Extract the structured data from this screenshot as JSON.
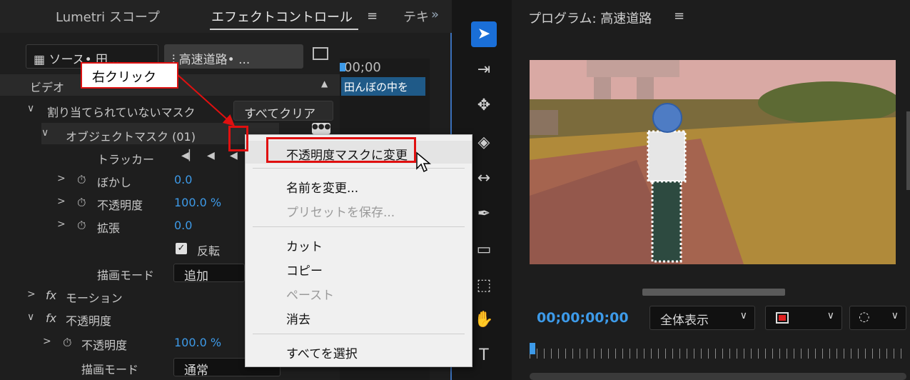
{
  "effect_panel": {
    "tabs": [
      "Lumetri スコープ",
      "エフェクトコントロール",
      "テキ"
    ],
    "tab_menu_icon": "hamburger-icon",
    "expand_icon": "double-chevron-right-icon",
    "source_button": "ソース• 田...",
    "sequence_button": "高速道路• ...",
    "timecode": "00;00",
    "clip_label": "田んぼの中を",
    "section_video": "ビデオ",
    "unassigned_masks": "割り当てられていないマスク",
    "clear_all_button": "すべてクリア",
    "object_mask": "オブジェクトマスク (01)",
    "tracker_label": "トラッカー",
    "blur_label": "ぼかし",
    "blur_value": "0.0",
    "opacity_label": "不透明度",
    "opacity_value": "100.0 %",
    "expand_label": "拡張",
    "expand_value": "0.0",
    "invert_label": "反転",
    "invert_checked": true,
    "blend_mode_label": "描画モード",
    "blend_mode_value": "追加",
    "motion_label": "モーション",
    "opacity_section_label": "不透明度",
    "opacity2_label": "不透明度",
    "opacity2_value": "100.0 %",
    "blend_mode2_label": "描画モード",
    "blend_mode2_value": "通常",
    "fx_label": "fx"
  },
  "tools": [
    "selection-tool-icon",
    "track-select-icon",
    "ripple-edit-icon",
    "razor-icon",
    "slip-icon",
    "pen-icon",
    "rectangle-icon",
    "hand-icon",
    "type-icon"
  ],
  "program": {
    "title": "プログラム: 高速道路",
    "menu_icon": "hamburger-icon",
    "timecode": "00;00;00;00",
    "fit_dropdown": "全体表示",
    "accent": "#3d9ae8"
  },
  "context_menu": {
    "items": [
      {
        "label": "不透明度マスクに変更",
        "enabled": true,
        "highlighted": true
      },
      {
        "label": "名前を変更...",
        "enabled": true
      },
      {
        "label": "プリセットを保存...",
        "enabled": false
      },
      {
        "label": "カット",
        "enabled": true
      },
      {
        "label": "コピー",
        "enabled": true
      },
      {
        "label": "ペースト",
        "enabled": false
      },
      {
        "label": "消去",
        "enabled": true
      },
      {
        "label": "すべてを選択",
        "enabled": true
      }
    ]
  },
  "annotation": {
    "callout_text": "右クリック",
    "color": "#e01010"
  }
}
